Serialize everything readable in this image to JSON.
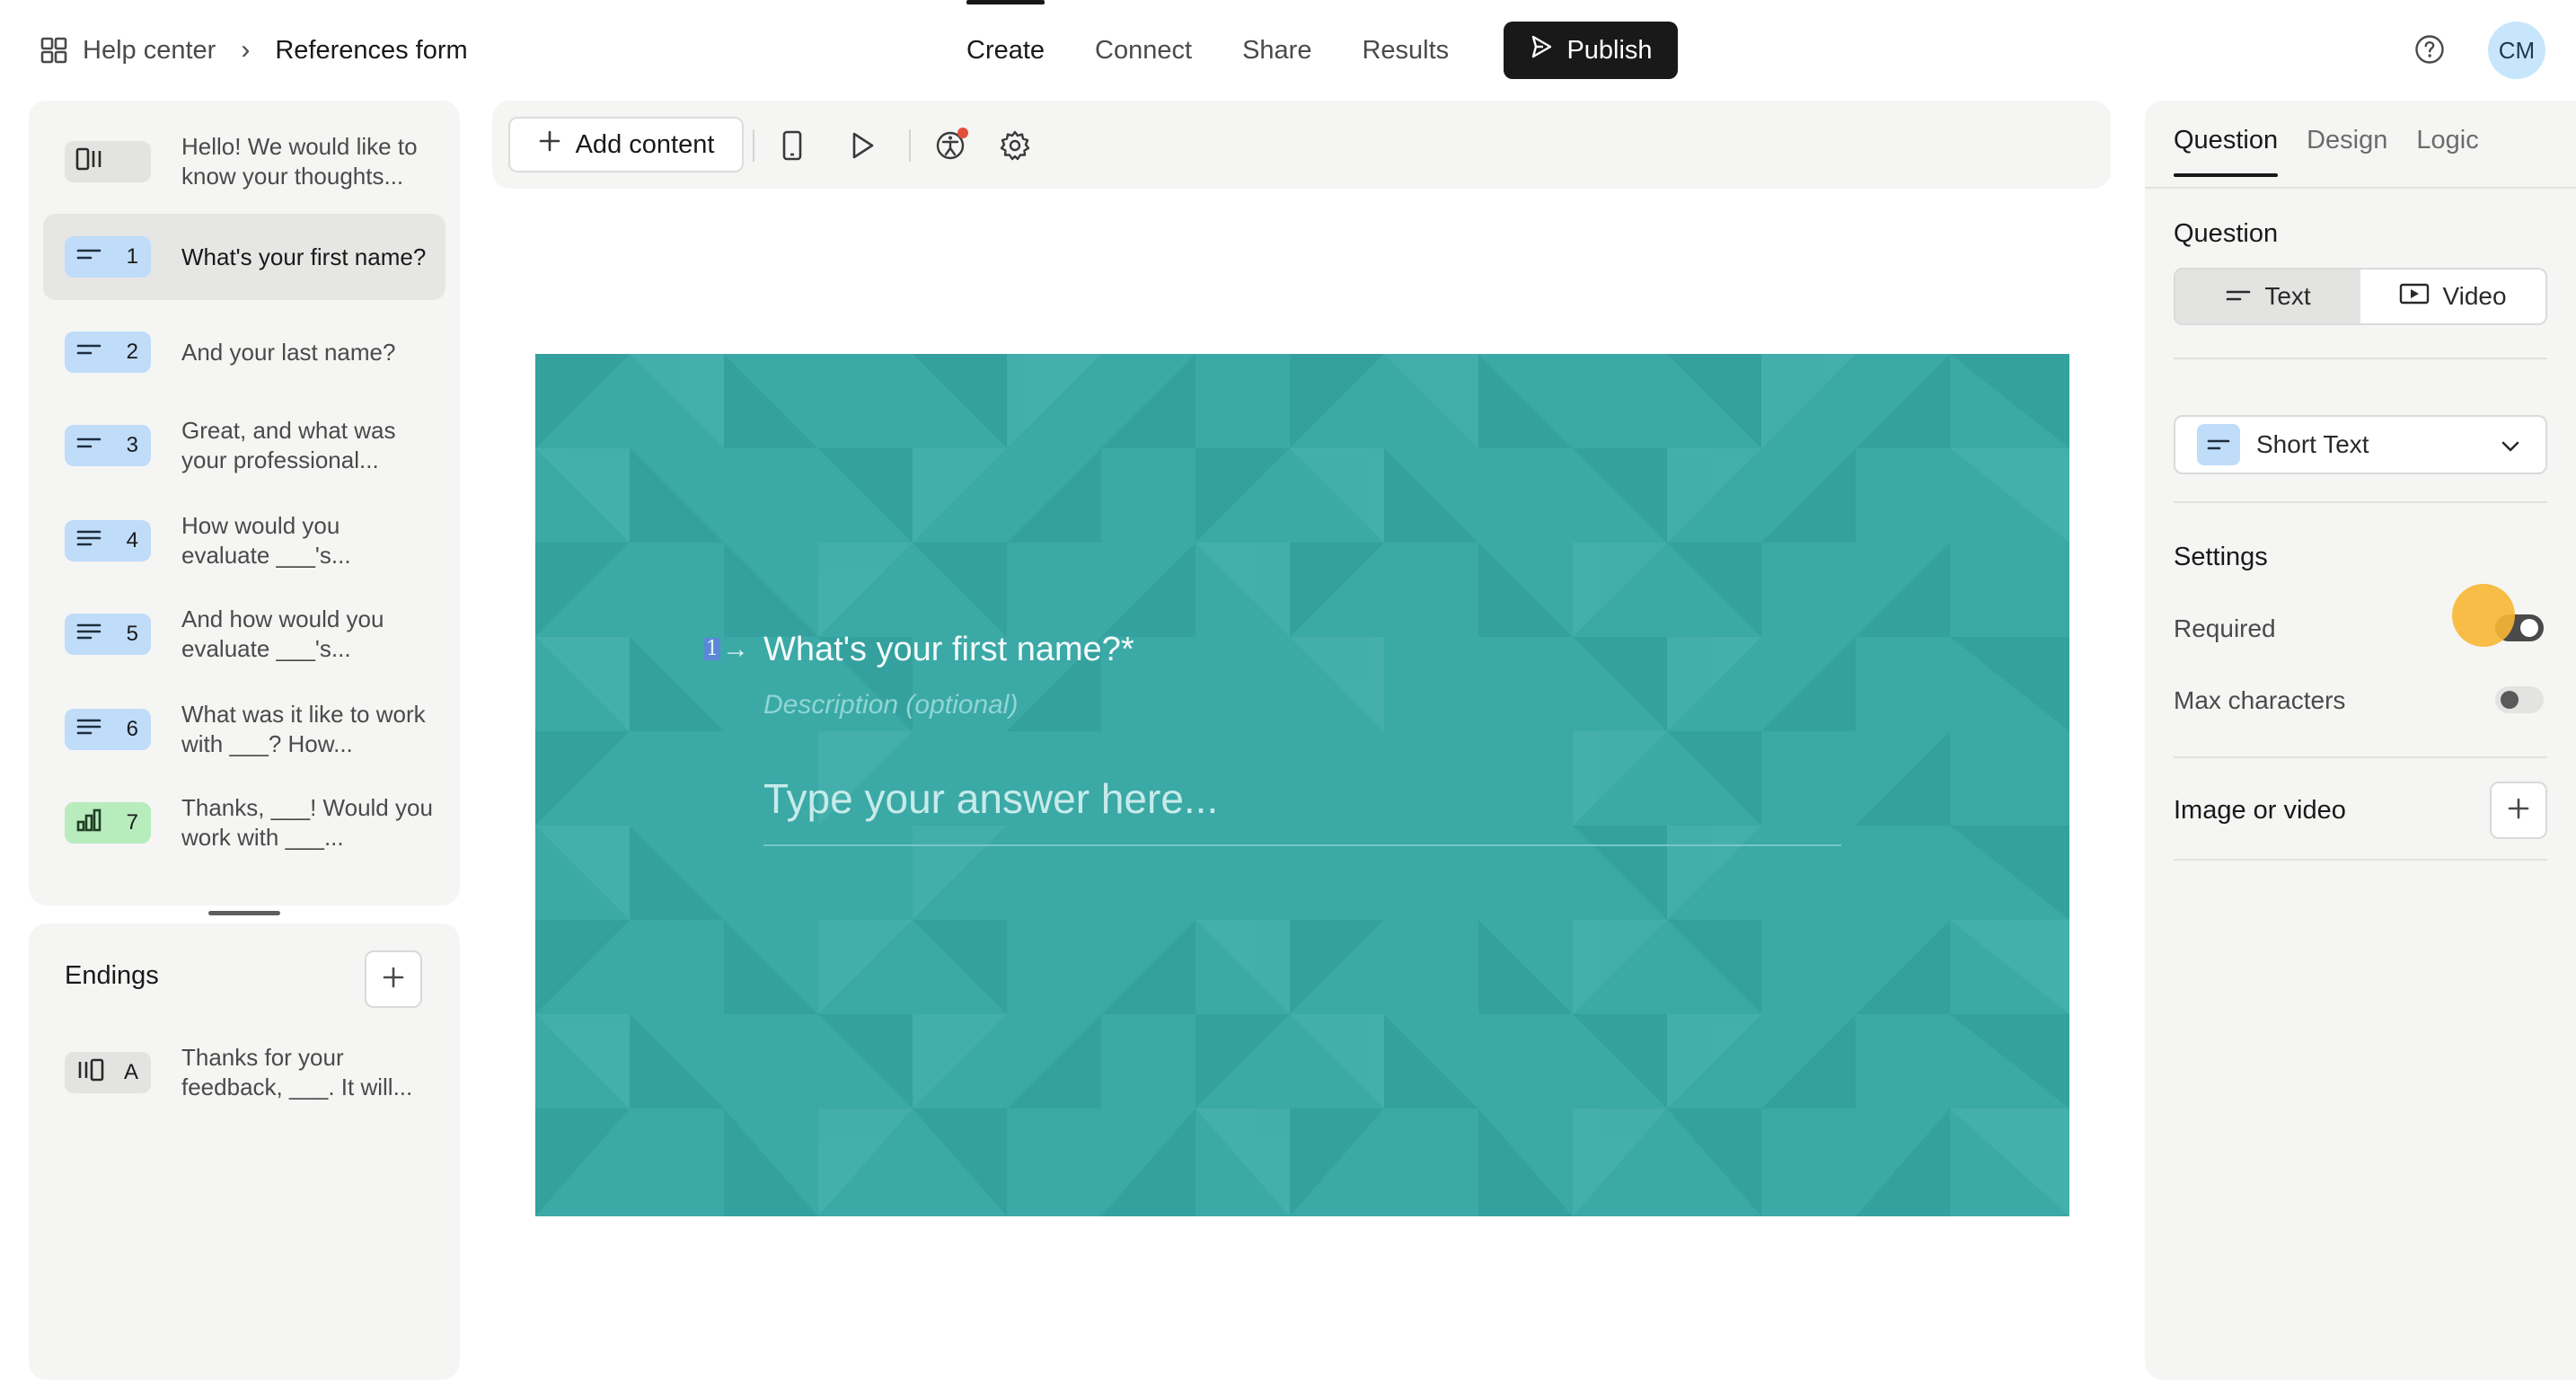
{
  "breadcrumb": {
    "home_label": "Help center",
    "separator": "›",
    "current_label": "References form"
  },
  "top_nav": {
    "create": "Create",
    "connect": "Connect",
    "share": "Share",
    "results": "Results",
    "publish": "Publish"
  },
  "user": {
    "initials": "CM"
  },
  "questions": [
    {
      "number": "",
      "text": "Hello! We would like to know your thoughts...",
      "type_icon": "welcome-screen-icon",
      "color": "#e3e3e2"
    },
    {
      "number": "1",
      "text": "What's your first name?",
      "type_icon": "short-text-icon",
      "color": "#bfdcf9",
      "selected": true
    },
    {
      "number": "2",
      "text": "And your last name?",
      "type_icon": "short-text-icon",
      "color": "#bfdcf9"
    },
    {
      "number": "3",
      "text": "Great, and what was your professional...",
      "type_icon": "short-text-icon",
      "color": "#bfdcf9"
    },
    {
      "number": "4",
      "text": "How would you evaluate ___'s...",
      "type_icon": "long-text-icon",
      "color": "#bfdcf9"
    },
    {
      "number": "5",
      "text": "And how would you evaluate ___'s...",
      "type_icon": "long-text-icon",
      "color": "#bfdcf9"
    },
    {
      "number": "6",
      "text": "What was it like to work with ___? How...",
      "type_icon": "long-text-icon",
      "color": "#bfdcf9"
    },
    {
      "number": "7",
      "text": "Thanks, ___! Would you work with ___...",
      "type_icon": "opinion-scale-icon",
      "color": "#b8ecbd"
    }
  ],
  "endings": {
    "title": "Endings",
    "items": [
      {
        "letter": "A",
        "text": "Thanks for your feedback, ___. It will...",
        "type_icon": "ending-screen-icon"
      }
    ]
  },
  "toolbar": {
    "add_content": "Add content"
  },
  "preview": {
    "number": "1",
    "arrow": "→",
    "question": "What's your first name?*",
    "description_placeholder": "Description (optional)",
    "answer_placeholder": "Type your answer here...",
    "background_color": "#3ba9a6"
  },
  "right_panel": {
    "tabs": [
      "Question",
      "Design",
      "Logic"
    ],
    "question_section_label": "Question",
    "question_modes": [
      "Text",
      "Video"
    ],
    "question_type": "Short Text",
    "settings_label": "Settings",
    "settings": [
      {
        "label": "Required",
        "on": true
      },
      {
        "label": "Max characters",
        "on": false
      }
    ],
    "image_or_video_label": "Image or video"
  }
}
